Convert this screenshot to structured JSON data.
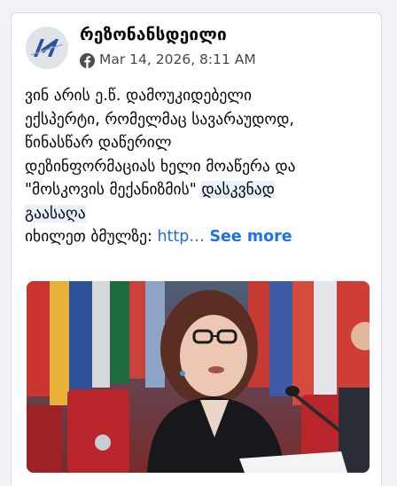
{
  "post": {
    "page_name": "რეზონანსდეილი",
    "timestamp": "Mar 14, 2026, 8:11 AM",
    "text_lines": [
      "ვინ არის ე.წ. დამოუკიდებელი",
      "ექსპერტი, რომელმაც სავარაუდოდ,",
      "წინასწარ დაწერილ",
      "დეზინფორმაციას ხელი მოაწერა და",
      "\"მოსკოვის მექანიზმის\""
    ],
    "highlight_part1": "დასკვნად",
    "highlight_part2": "გაასაღა",
    "watch_label": "იხილეთ ბმულზე: ",
    "link_text": "http…",
    "see_more": "See more"
  },
  "icons": {
    "avatar": "rezonansi-logo-icon",
    "platform": "facebook-icon"
  },
  "colors": {
    "link": "#216fdb",
    "see_more": "#1a73e8",
    "highlight": "#e7f0fc",
    "logo_blue": "#2b4fa0"
  }
}
